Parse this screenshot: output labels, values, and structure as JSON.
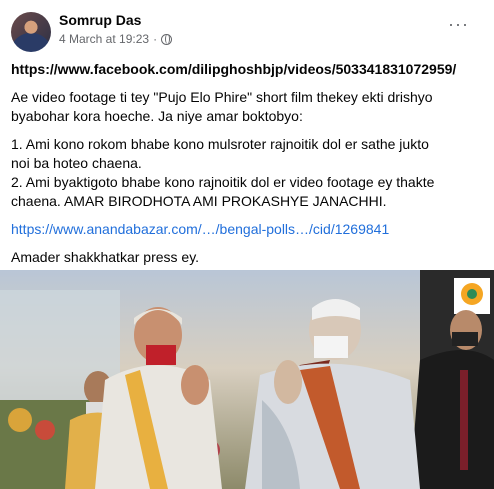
{
  "post": {
    "author": "Somrup Das",
    "timestamp": "4 March at 19:23",
    "privacy_icon": "globe-icon",
    "more_icon": "more-options-icon",
    "more_label": "···",
    "lines": {
      "link_main": "https://www.facebook.com/dilipghoshbjp/videos/503341831072959/",
      "para1_line1": "Ae video footage ti tey \"Pujo Elo Phire\" short film thekey ekti drishyo",
      "para1_line2": "byabohar kora hoeche. Ja niye amar boktobyo:",
      "para2_line1": "1. Ami kono rokom bhabe kono mulsroter rajnoitik dol er sathe jukto",
      "para2_line2": "noi ba hoteo chaena.",
      "para2_line3": "2. Ami byaktigoto bhabe kono rajnoitik  dol er video footage ey thakte",
      "para2_line4": "chaena. AMAR BIRODHOTA AMI PROKASHYE JANACHHI.",
      "link_secondary": "https://www.anandabazar.com/…/bengal-polls…/cid/1269841",
      "closing": "Amader shakkhatkar press ey."
    }
  },
  "video": {
    "logo_icon": "party-logo-icon",
    "description": "two men in traditional dress greeting with folded hands on stage"
  },
  "colors": {
    "link_blue": "#216fdb",
    "secondary_text": "#65676b"
  }
}
